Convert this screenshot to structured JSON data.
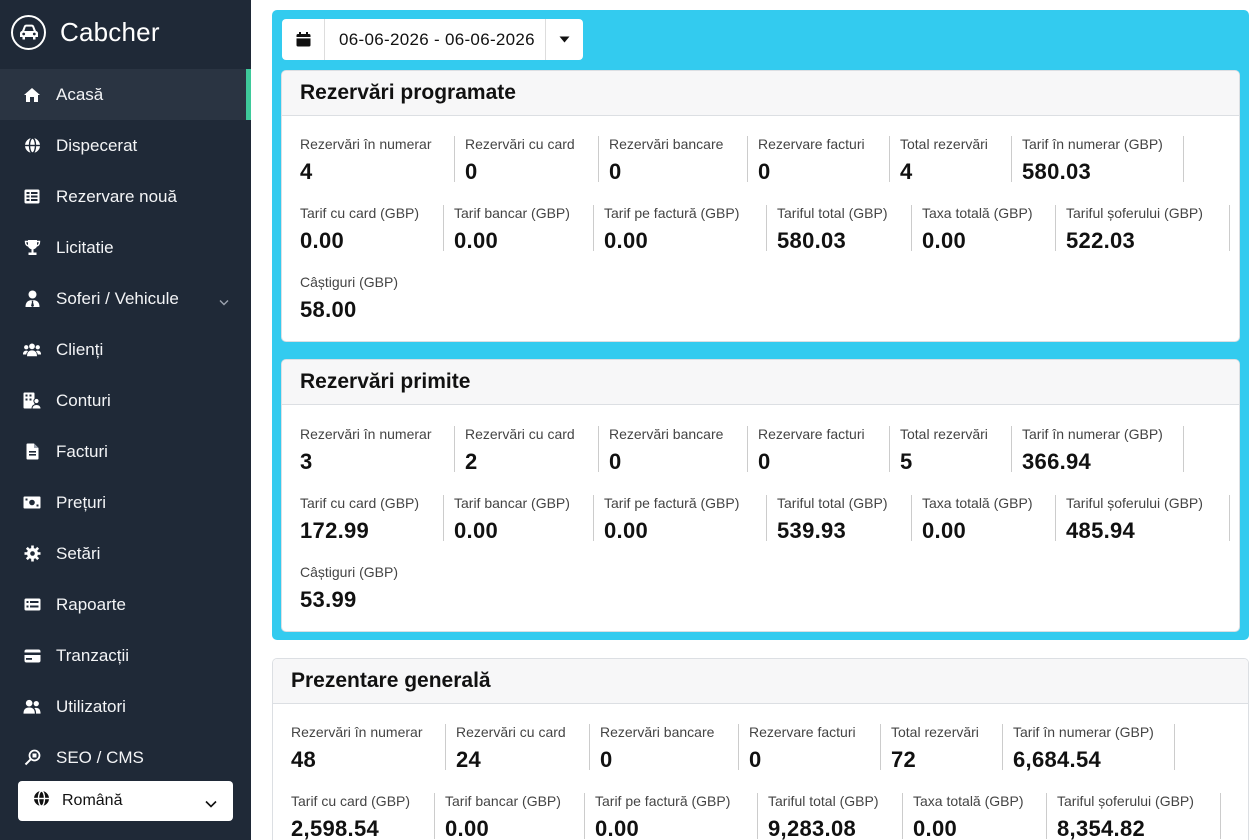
{
  "app": {
    "title": "Cabcher"
  },
  "sidebar": {
    "items": [
      {
        "label": "Acasă",
        "icon": "home-icon",
        "active": true
      },
      {
        "label": "Dispecerat",
        "icon": "globe-icon"
      },
      {
        "label": "Rezervare nouă",
        "icon": "table-icon"
      },
      {
        "label": "Licitatie",
        "icon": "trophy-icon"
      },
      {
        "label": "Soferi / Vehicule",
        "icon": "user-tie-icon",
        "has_submenu": true
      },
      {
        "label": "Clienți",
        "icon": "users-icon"
      },
      {
        "label": "Conturi",
        "icon": "building-user-icon"
      },
      {
        "label": "Facturi",
        "icon": "file-icon"
      },
      {
        "label": "Prețuri",
        "icon": "money-bill-icon"
      },
      {
        "label": "Setări",
        "icon": "gear-icon"
      },
      {
        "label": "Rapoarte",
        "icon": "list-card-icon"
      },
      {
        "label": "Tranzacții",
        "icon": "wallet-icon"
      },
      {
        "label": "Utilizatori",
        "icon": "user-group-icon"
      },
      {
        "label": "SEO / CMS",
        "icon": "magnify-icon"
      }
    ],
    "language": {
      "selected": "Română"
    }
  },
  "date_range": {
    "value": "06-06-2026 - 06-06-2026"
  },
  "sections": [
    {
      "title": "Rezervări programate",
      "rows": [
        [
          {
            "label": "Rezervări în numerar",
            "value": "4"
          },
          {
            "label": "Rezervări cu card",
            "value": "0"
          },
          {
            "label": "Rezervări bancare",
            "value": "0"
          },
          {
            "label": "Rezervare facturi",
            "value": "0"
          },
          {
            "label": "Total rezervări",
            "value": "4"
          },
          {
            "label": "Tarif în numerar (GBP)",
            "value": "580.03"
          }
        ],
        [
          {
            "label": "Tarif cu card (GBP)",
            "value": "0.00"
          },
          {
            "label": "Tarif bancar (GBP)",
            "value": "0.00"
          },
          {
            "label": "Tarif pe factură (GBP)",
            "value": "0.00"
          },
          {
            "label": "Tariful total (GBP)",
            "value": "580.03"
          },
          {
            "label": "Taxa totală (GBP)",
            "value": "0.00"
          },
          {
            "label": "Tariful șoferului (GBP)",
            "value": "522.03"
          }
        ],
        [
          {
            "label": "Câștiguri (GBP)",
            "value": "58.00"
          }
        ]
      ]
    },
    {
      "title": "Rezervări primite",
      "rows": [
        [
          {
            "label": "Rezervări în numerar",
            "value": "3"
          },
          {
            "label": "Rezervări cu card",
            "value": "2"
          },
          {
            "label": "Rezervări bancare",
            "value": "0"
          },
          {
            "label": "Rezervare facturi",
            "value": "0"
          },
          {
            "label": "Total rezervări",
            "value": "5"
          },
          {
            "label": "Tarif în numerar (GBP)",
            "value": "366.94"
          }
        ],
        [
          {
            "label": "Tarif cu card (GBP)",
            "value": "172.99"
          },
          {
            "label": "Tarif bancar (GBP)",
            "value": "0.00"
          },
          {
            "label": "Tarif pe factură (GBP)",
            "value": "0.00"
          },
          {
            "label": "Tariful total (GBP)",
            "value": "539.93"
          },
          {
            "label": "Taxa totală (GBP)",
            "value": "0.00"
          },
          {
            "label": "Tariful șoferului (GBP)",
            "value": "485.94"
          }
        ],
        [
          {
            "label": "Câștiguri (GBP)",
            "value": "53.99"
          }
        ]
      ]
    },
    {
      "title": "Prezentare generală",
      "rows": [
        [
          {
            "label": "Rezervări în numerar",
            "value": "48"
          },
          {
            "label": "Rezervări cu card",
            "value": "24"
          },
          {
            "label": "Rezervări bancare",
            "value": "0"
          },
          {
            "label": "Rezervare facturi",
            "value": "0"
          },
          {
            "label": "Total rezervări",
            "value": "72"
          },
          {
            "label": "Tarif în numerar (GBP)",
            "value": "6,684.54"
          }
        ],
        [
          {
            "label": "Tarif cu card (GBP)",
            "value": "2,598.54"
          },
          {
            "label": "Tarif bancar (GBP)",
            "value": "0.00"
          },
          {
            "label": "Tarif pe factură (GBP)",
            "value": "0.00"
          },
          {
            "label": "Tariful total (GBP)",
            "value": "9,283.08"
          },
          {
            "label": "Taxa totală (GBP)",
            "value": "0.00"
          },
          {
            "label": "Tariful șoferului (GBP)",
            "value": "8,354.82"
          }
        ]
      ]
    }
  ],
  "colors": {
    "sidebar": "#1f2937",
    "panel": "#33cbef",
    "active_marker": "#3ec99a"
  }
}
